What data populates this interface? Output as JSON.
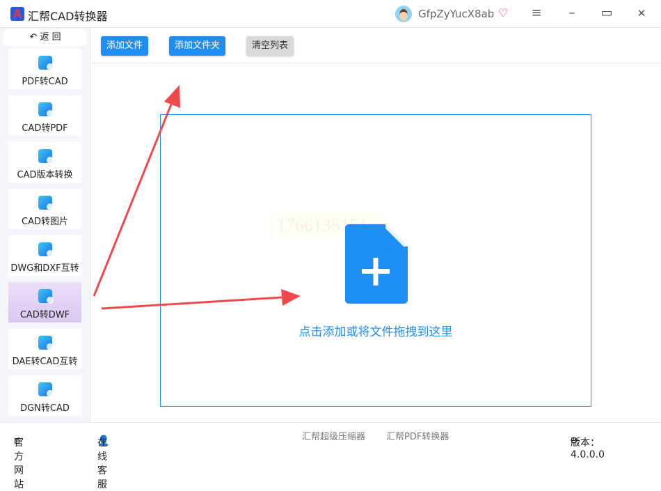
{
  "app": {
    "title": "汇帮CAD转换器",
    "logo_letter": "A",
    "username": "GfpZyYucX8ab"
  },
  "window": {
    "menu": "≡",
    "minimize": "–",
    "maximize": "▭",
    "close": "✕"
  },
  "sidebar": {
    "back_label": "返 回",
    "active_index": 5,
    "items": [
      {
        "label": "PDF转CAD"
      },
      {
        "label": "CAD转PDF"
      },
      {
        "label": "CAD版本转换"
      },
      {
        "label": "CAD转图片"
      },
      {
        "label": "DWG和DXF互转"
      },
      {
        "label": "CAD转DWF"
      },
      {
        "label": "DAE转CAD互转"
      },
      {
        "label": "DGN转CAD"
      }
    ]
  },
  "toolbar": {
    "add_file": "添加文件",
    "add_folder": "添加文件夹",
    "clear_list": "清空列表"
  },
  "dropzone": {
    "text": "点击添加或将文件拖拽到这里",
    "watermark": "1766135151"
  },
  "footer": {
    "website": "官方网站",
    "support": "在线客服",
    "link1": "汇帮超级压缩器",
    "link2": "汇帮PDF转换器",
    "version": "版本：4.0.0.0"
  },
  "colors": {
    "accent": "#1e8ef5",
    "active_item": "#d9c8f2",
    "arrow": "#f0484b"
  }
}
